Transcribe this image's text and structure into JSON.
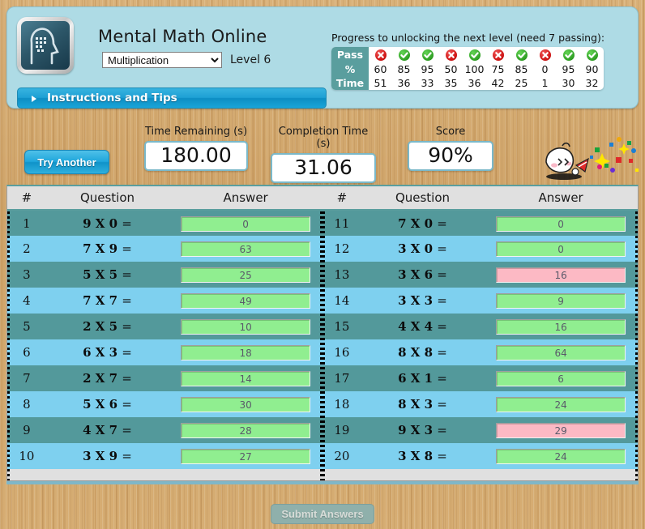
{
  "app": {
    "title": "Mental Math Online",
    "logo_icon": "head-profile-pixels-icon",
    "level_label": "Level 6",
    "subject_selected": "Multiplication",
    "subject_options": [
      "Multiplication"
    ],
    "instructions_label": "Instructions and Tips",
    "instructions_icon": "triangle-right-icon"
  },
  "progress": {
    "title": "Progress to unlocking the next level (need 7 passing):",
    "row_labels": {
      "pass": "Pass",
      "percent": "%",
      "time": "Time"
    },
    "pass": [
      "fail",
      "pass",
      "pass",
      "fail",
      "pass",
      "fail",
      "pass",
      "fail",
      "pass",
      "pass"
    ],
    "percent": [
      "60",
      "85",
      "95",
      "50",
      "100",
      "75",
      "85",
      "0",
      "95",
      "90"
    ],
    "time": [
      "51",
      "36",
      "33",
      "35",
      "36",
      "42",
      "25",
      "1",
      "30",
      "32"
    ],
    "pass_icon": "check-circle-icon",
    "fail_icon": "x-circle-icon",
    "header_bg": "#5a9e9e"
  },
  "stats": {
    "try_another_label": "Try Another",
    "time_remaining_label": "Time Remaining (s)",
    "time_remaining_value": "180.00",
    "completion_time_label": "Completion Time (s)",
    "completion_time_value": "31.06",
    "score_label": "Score",
    "score_value": "90%",
    "mascot_icon": "celebration-mascot-icon"
  },
  "table": {
    "headers": {
      "num": "#",
      "question": "Question",
      "answer": "Answer"
    },
    "left_rows": [
      {
        "num": "1",
        "question": "9 X 0",
        "eq": "=",
        "answer": "0",
        "correct": true
      },
      {
        "num": "2",
        "question": "7 X 9",
        "eq": "=",
        "answer": "63",
        "correct": true
      },
      {
        "num": "3",
        "question": "5 X 5",
        "eq": "=",
        "answer": "25",
        "correct": true
      },
      {
        "num": "4",
        "question": "7 X 7",
        "eq": "=",
        "answer": "49",
        "correct": true
      },
      {
        "num": "5",
        "question": "2 X 5",
        "eq": "=",
        "answer": "10",
        "correct": true
      },
      {
        "num": "6",
        "question": "6 X 3",
        "eq": "=",
        "answer": "18",
        "correct": true
      },
      {
        "num": "7",
        "question": "2 X 7",
        "eq": "=",
        "answer": "14",
        "correct": true
      },
      {
        "num": "8",
        "question": "5 X 6",
        "eq": "=",
        "answer": "30",
        "correct": true
      },
      {
        "num": "9",
        "question": "4 X 7",
        "eq": "=",
        "answer": "28",
        "correct": true
      },
      {
        "num": "10",
        "question": "3 X 9",
        "eq": "=",
        "answer": "27",
        "correct": true
      }
    ],
    "right_rows": [
      {
        "num": "11",
        "question": "7 X 0",
        "eq": "=",
        "answer": "0",
        "correct": true
      },
      {
        "num": "12",
        "question": "3 X 0",
        "eq": "=",
        "answer": "0",
        "correct": true
      },
      {
        "num": "13",
        "question": "3 X 6",
        "eq": "=",
        "answer": "16",
        "correct": false
      },
      {
        "num": "14",
        "question": "3 X 3",
        "eq": "=",
        "answer": "9",
        "correct": true
      },
      {
        "num": "15",
        "question": "4 X 4",
        "eq": "=",
        "answer": "16",
        "correct": true
      },
      {
        "num": "16",
        "question": "8 X 8",
        "eq": "=",
        "answer": "64",
        "correct": true
      },
      {
        "num": "17",
        "question": "6 X 1",
        "eq": "=",
        "answer": "6",
        "correct": true
      },
      {
        "num": "18",
        "question": "8 X 3",
        "eq": "=",
        "answer": "24",
        "correct": true
      },
      {
        "num": "19",
        "question": "9 X 3",
        "eq": "=",
        "answer": "29",
        "correct": false
      },
      {
        "num": "20",
        "question": "3 X 8",
        "eq": "=",
        "answer": "24",
        "correct": true
      }
    ]
  },
  "footer": {
    "submit_label": "Submit Answers",
    "submit_disabled": true
  },
  "colors": {
    "panel_bg": "#aedbe5",
    "row_dark": "#53999b",
    "row_light": "#7ed0ef",
    "answer_correct": "#90ee90",
    "answer_wrong": "#fcb9c4",
    "accent_blue": "#1fa6dc",
    "teal_header": "#5a9e9e",
    "page_bg": "#d4a86a"
  }
}
